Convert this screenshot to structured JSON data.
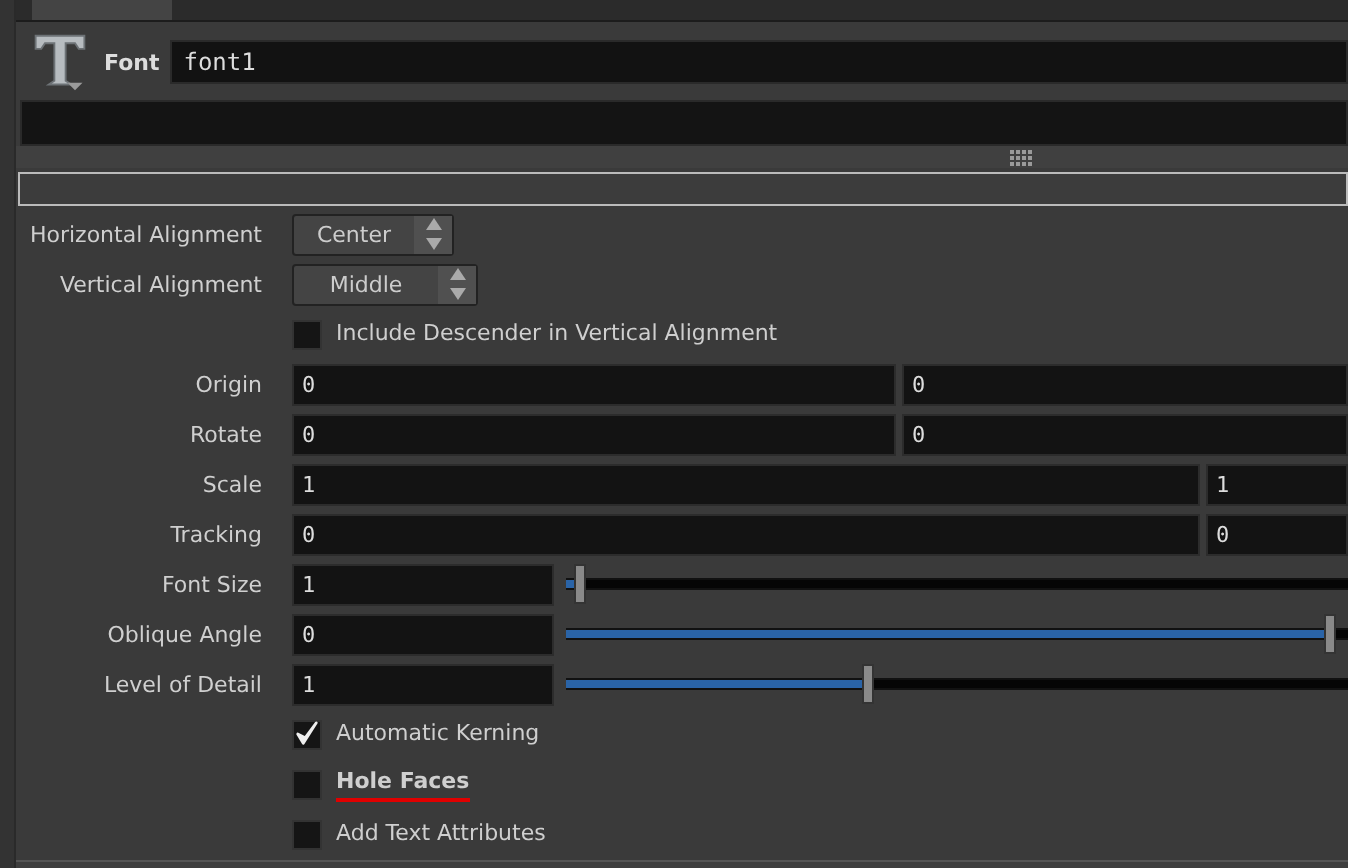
{
  "node": {
    "type_label": "Font",
    "name": "font1"
  },
  "parameters": [
    {
      "kind": "menu",
      "label": "Horizontal Alignment",
      "value": "Center"
    },
    {
      "kind": "menu",
      "label": "Vertical Alignment",
      "value": "Middle"
    },
    {
      "kind": "toggle",
      "label": "Include Descender in Vertical Alignment",
      "checked": false,
      "highlighted": false
    },
    {
      "kind": "vector",
      "label": "Origin",
      "values": [
        "0",
        "0"
      ]
    },
    {
      "kind": "vector",
      "label": "Rotate",
      "values": [
        "0",
        "0"
      ]
    },
    {
      "kind": "vector",
      "label": "Scale",
      "values": [
        "1",
        "1"
      ]
    },
    {
      "kind": "vector",
      "label": "Tracking",
      "values": [
        "0",
        "0"
      ]
    },
    {
      "kind": "slider",
      "label": "Font Size",
      "value": "1",
      "level": 0.02
    },
    {
      "kind": "slider",
      "label": "Oblique Angle",
      "value": "0",
      "level": 0.98
    },
    {
      "kind": "slider",
      "label": "Level of Detail",
      "value": "1",
      "level": 0.39
    },
    {
      "kind": "toggle",
      "label": "Automatic Kerning",
      "checked": true,
      "highlighted": false
    },
    {
      "kind": "toggle",
      "label": "Hole Faces",
      "checked": false,
      "highlighted": true
    },
    {
      "kind": "toggle",
      "label": "Add Text Attributes",
      "checked": false,
      "highlighted": false
    }
  ]
}
